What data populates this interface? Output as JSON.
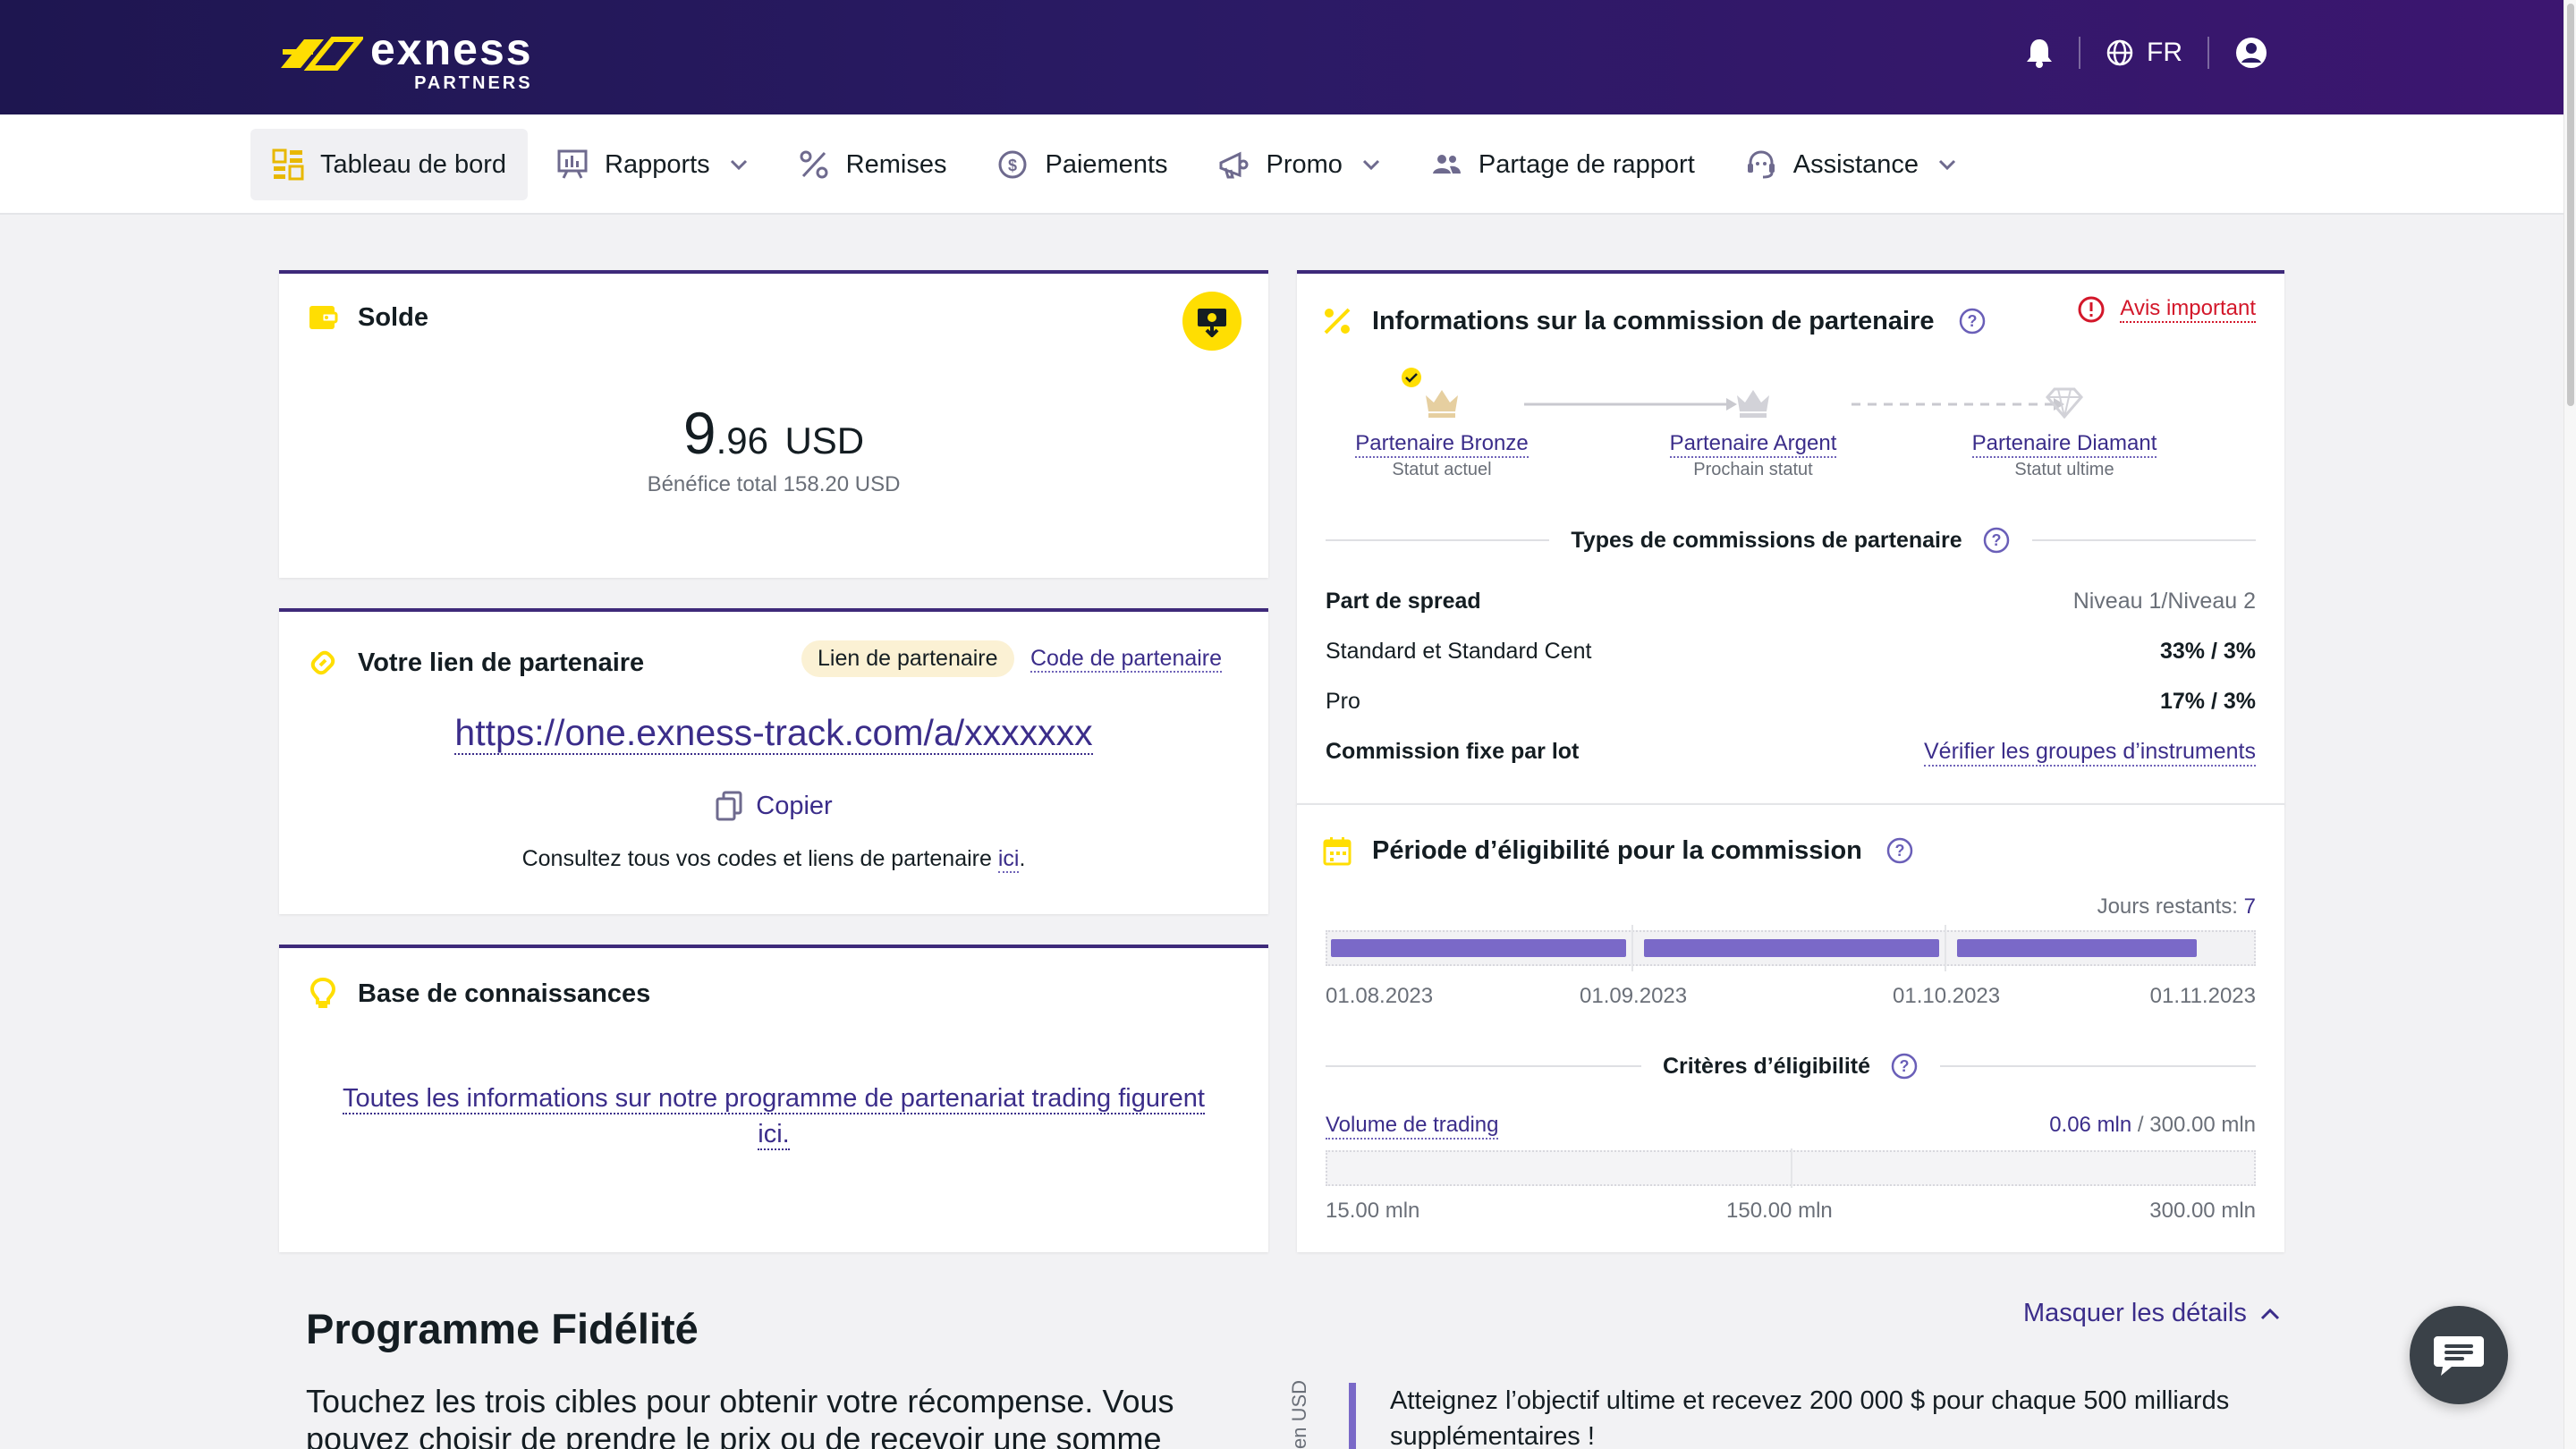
{
  "brand": {
    "word": "exness",
    "sub": "PARTNERS"
  },
  "header": {
    "language": "FR"
  },
  "nav": {
    "items": [
      {
        "label": "Tableau de bord"
      },
      {
        "label": "Rapports"
      },
      {
        "label": "Remises"
      },
      {
        "label": "Paiements"
      },
      {
        "label": "Promo"
      },
      {
        "label": "Partage de rapport"
      },
      {
        "label": "Assistance"
      }
    ]
  },
  "balance": {
    "title": "Solde",
    "amount_int": "9",
    "amount_dec": ".96",
    "currency": "USD",
    "total_profit": "Bénéfice total 158.20 USD"
  },
  "partner_link": {
    "title": "Votre lien de partenaire",
    "tab_link": "Lien de partenaire",
    "tab_code": "Code de partenaire",
    "url": "https://one.exness-track.com/a/xxxxxxx",
    "copy": "Copier",
    "consult_text": "Consultez tous vos codes et liens de partenaire ",
    "consult_link": "ici",
    "consult_end": "."
  },
  "knowledge": {
    "title": "Base de connaissances",
    "text": "Toutes les informations sur notre programme de partenariat trading figurent ici."
  },
  "commission": {
    "title": "Informations sur la commission de partenaire",
    "notice": "Avis important",
    "statuses": [
      {
        "name": "Partenaire Bronze",
        "desc": "Statut actuel"
      },
      {
        "name": "Partenaire Argent",
        "desc": "Prochain statut"
      },
      {
        "name": "Partenaire Diamant",
        "desc": "Statut ultime"
      }
    ],
    "types_title": "Types de commissions de partenaire",
    "rows": [
      {
        "label": "Part de spread",
        "value": "Niveau 1/Niveau 2"
      },
      {
        "label": "Standard et Standard Cent",
        "value": "33% / 3%"
      },
      {
        "label": "Pro",
        "value": "17% / 3%"
      },
      {
        "label": "Commission fixe par lot",
        "value": "Vérifier les groupes d’instruments"
      }
    ]
  },
  "eligibility": {
    "title": "Période d’éligibilité pour la commission",
    "days_label": "Jours restants:",
    "days_value": "7",
    "period_progress": 0.93,
    "dates": [
      "01.08.2023",
      "01.09.2023",
      "01.10.2023",
      "01.11.2023"
    ],
    "criteria_title": "Critères d’éligibilité",
    "volume_label": "Volume de trading",
    "volume_current": "0.06 mln",
    "volume_target": " / 300.00 mln",
    "volume_marks": [
      "15.00 mln",
      "150.00 mln",
      "300.00 mln"
    ]
  },
  "loyalty": {
    "title": "Programme Fidélité",
    "toggle": "Masquer les détails",
    "text": "Touchez les trois cibles pour obtenir votre récompense. Vous pouvez choisir de prendre le prix ou de recevoir une somme",
    "axis_label": "en USD",
    "goal_text": "Atteignez l’objectif ultime et recevez 200 000 $ pour chaque 500 milliards supplémentaires !"
  },
  "colors": {
    "accent": "#3e2a7a",
    "brand_yellow": "#ffde02",
    "bar": "#7a69c8",
    "danger": "#d3172a"
  },
  "icons": [
    "bell-icon",
    "globe-icon",
    "user-icon",
    "dashboard-icon",
    "reports-icon",
    "percent-icon",
    "payment-icon",
    "promo-icon",
    "people-icon",
    "support-icon",
    "wallet-icon",
    "link-icon",
    "bulb-icon",
    "calendar-icon",
    "help-icon",
    "alert-icon",
    "crown-icon",
    "diamond-icon",
    "copy-icon",
    "chat-icon"
  ]
}
